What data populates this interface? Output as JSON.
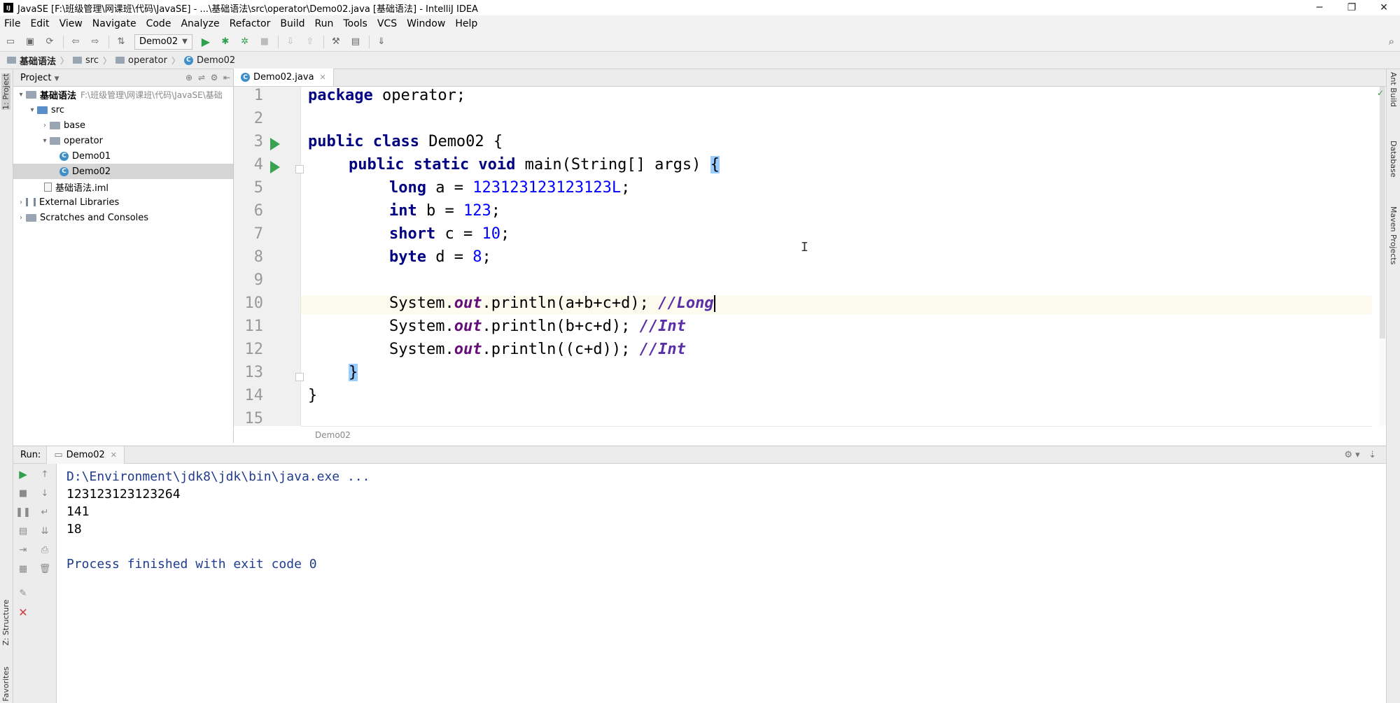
{
  "window": {
    "title": "JavaSE [F:\\班级管理\\网课班\\代码\\JavaSE] - ...\\基础语法\\src\\operator\\Demo02.java [基础语法] - IntelliJ IDEA",
    "app_icon": "IJ",
    "minimize": "─",
    "restore": "❐",
    "close": "✕"
  },
  "menu": [
    "File",
    "Edit",
    "View",
    "Navigate",
    "Code",
    "Analyze",
    "Refactor",
    "Build",
    "Run",
    "Tools",
    "VCS",
    "Window",
    "Help"
  ],
  "toolbar": {
    "run_config": "Demo02"
  },
  "breadcrumb": [
    "基础语法",
    "src",
    "operator",
    "Demo02"
  ],
  "left_stripe": {
    "project_label": "1: Project",
    "structure_label": "Z: Structure",
    "favorites_label": "Favorites"
  },
  "right_stripe": [
    "Ant Build",
    "Database",
    "Maven Projects"
  ],
  "project": {
    "header": "Project",
    "root_name": "基础语法",
    "root_path": "F:\\班级管理\\网课班\\代码\\JavaSE\\基础",
    "src": "src",
    "base": "base",
    "operator": "operator",
    "demo01": "Demo01",
    "demo02": "Demo02",
    "iml": "基础语法.iml",
    "external_libraries": "External Libraries",
    "scratches": "Scratches and Consoles"
  },
  "editor": {
    "tab": "Demo02.java",
    "line_numbers": [
      "1",
      "2",
      "3",
      "4",
      "5",
      "6",
      "7",
      "8",
      "9",
      "10",
      "11",
      "12",
      "13",
      "14",
      "15"
    ],
    "lines": {
      "l1_kw": "package",
      "l1_rest": " operator;",
      "l3_kw": "public class",
      "l3_rest": " Demo02 {",
      "l4_kw": "public static void",
      "l4_rest": " main(String[] args) ",
      "l4_brace": "{",
      "l5_kw": "long",
      "l5_rest": " a = ",
      "l5_num": "123123123123123L",
      "l5_end": ";",
      "l6_kw": "int",
      "l6_rest": " b = ",
      "l6_num": "123",
      "l6_end": ";",
      "l7_kw": "short",
      "l7_rest": " c = ",
      "l7_num": "10",
      "l7_end": ";",
      "l8_kw": "byte",
      "l8_rest": " d = ",
      "l8_num": "8",
      "l8_end": ";",
      "sys": "System.",
      "out": "out",
      "l10_call": ".println(a+b+c+d); ",
      "l10_cmt": "//Long",
      "l11_call": ".println(b+c+d); ",
      "l11_cmt": "//Int",
      "l12_call": ".println((c+d)); ",
      "l12_cmt": "//Int",
      "l13_brace": "}",
      "l14_brace": "}"
    },
    "breadcrumb": "Demo02"
  },
  "run_panel": {
    "label": "Run:",
    "tab": "Demo02",
    "console": [
      "D:\\Environment\\jdk8\\jdk\\bin\\java.exe ...",
      "123123123123264",
      "141",
      "18",
      "",
      "Process finished with exit code 0"
    ]
  },
  "colors": {
    "keyword": "#000080",
    "number": "#0000ff",
    "static_field": "#660e7a",
    "comment": "#5a2fa8",
    "run_green": "#2da14e"
  }
}
